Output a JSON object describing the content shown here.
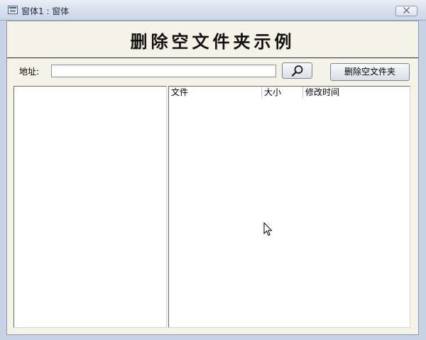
{
  "window": {
    "title": "窗体1 : 窗体",
    "close_symbol": "⨉"
  },
  "header": {
    "title": "删除空文件夹示例"
  },
  "address": {
    "label": "地址:",
    "value": "",
    "placeholder": ""
  },
  "search_button": {
    "icon": "search-icon"
  },
  "delete_button": {
    "label": "删除空文件夹"
  },
  "file_list": {
    "columns": [
      "文件",
      "大小",
      "修改时间"
    ],
    "rows": []
  },
  "tree": {
    "items": []
  }
}
